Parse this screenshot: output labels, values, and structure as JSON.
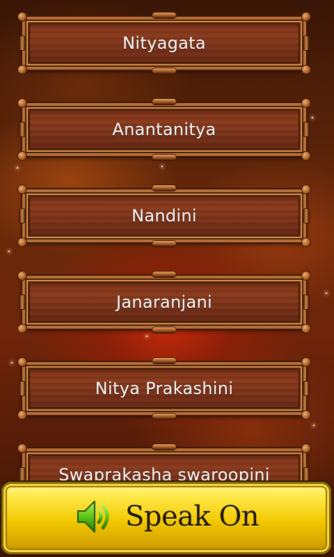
{
  "list": {
    "items": [
      {
        "label": "Nityagata"
      },
      {
        "label": "Anantanitya"
      },
      {
        "label": "Nandini"
      },
      {
        "label": "Janaranjani"
      },
      {
        "label": "Nitya Prakashini"
      },
      {
        "label": "Swaprakasha swaroopini"
      }
    ]
  },
  "speak_button": {
    "label": "Speak On",
    "icon": "speaker-volume-icon"
  },
  "colors": {
    "speak_bg": "#f2c800",
    "frame_border": "#b8703a",
    "label_text": "#ffffff"
  }
}
